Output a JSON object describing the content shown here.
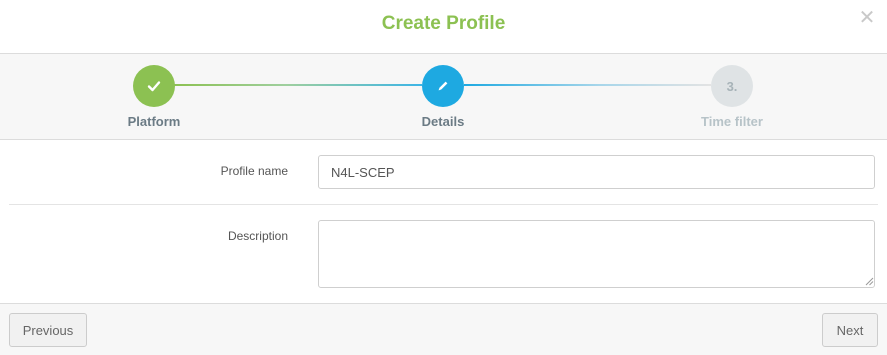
{
  "dialog": {
    "title": "Create Profile",
    "close_icon": "close-icon"
  },
  "wizard": {
    "steps": [
      {
        "label": "Platform",
        "state": "completed",
        "icon": "check-icon",
        "color": "#8cc152"
      },
      {
        "label": "Details",
        "state": "active",
        "icon": "pencil-icon",
        "color": "#1ea9e1"
      },
      {
        "label": "Time filter",
        "state": "pending",
        "marker": "3.",
        "color": "#dfe3e5"
      }
    ]
  },
  "form": {
    "profile_name_label": "Profile name",
    "profile_name_value": "N4L-SCEP",
    "description_label": "Description",
    "description_value": ""
  },
  "footer": {
    "previous_label": "Previous",
    "next_label": "Next"
  },
  "colors": {
    "accent_green": "#8cc152",
    "accent_blue": "#1ea9e1"
  }
}
